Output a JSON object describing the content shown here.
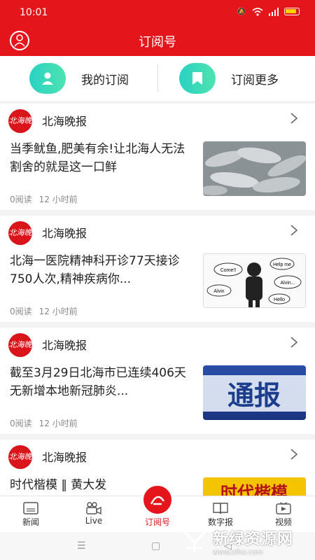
{
  "status": {
    "time": "10:01"
  },
  "header": {
    "title": "订阅号"
  },
  "subscribe": {
    "mine": "我的订阅",
    "more": "订阅更多"
  },
  "cards": [
    {
      "source": "北海晚报",
      "logo_text": "北海晚报",
      "headline": "当季鱿鱼,肥美有余!让北海人无法割舍的就是这一口鲜",
      "reads": "0阅读",
      "time": "12 小时前"
    },
    {
      "source": "北海晚报",
      "logo_text": "北海晚报",
      "headline": "北海一医院精神科开诊77天接诊750人次,精神疾病你...",
      "reads": "0阅读",
      "time": "12 小时前"
    },
    {
      "source": "北海晚报",
      "logo_text": "北海晚报",
      "headline": "截至3月29日北海市已连续406天无新增本地新冠肺炎...",
      "reads": "0阅读",
      "time": "12 小时前"
    },
    {
      "source": "北海晚报",
      "logo_text": "北海晚报",
      "headline": "时代楷模 ‖ 黄大发",
      "reads": "",
      "time": ""
    }
  ],
  "thumbs": {
    "card3": "通报",
    "card4": "时代楷模",
    "card2_bubbles": [
      "Come!!",
      "Help me",
      "Alvin...",
      "Alvin",
      "Hello"
    ]
  },
  "tabs": [
    {
      "label": "新闻",
      "icon": "news-icon"
    },
    {
      "label": "Live",
      "icon": "video-camera-icon"
    },
    {
      "label": "订阅号",
      "icon": "subscribe-icon"
    },
    {
      "label": "数字报",
      "icon": "book-icon"
    },
    {
      "label": "视频",
      "icon": "play-icon"
    }
  ],
  "watermark": {
    "title": "新绿资源网",
    "url": "www.xlhs.com"
  },
  "colors": {
    "brand": "#e4151b",
    "accent": "#2ad2c3"
  }
}
